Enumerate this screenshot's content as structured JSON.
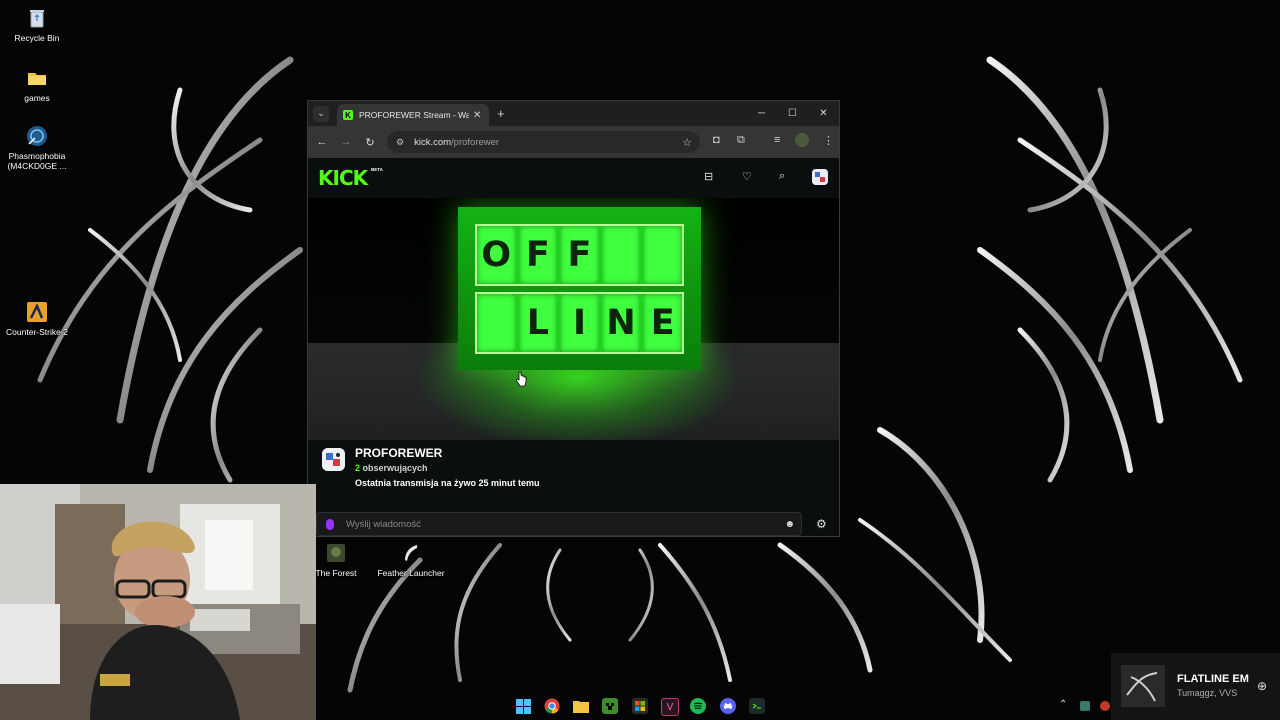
{
  "desktop": {
    "icons": [
      {
        "label": "Recycle Bin"
      },
      {
        "label": "games"
      },
      {
        "label": "Phasmophobia (M4CKD0GE ..."
      },
      {
        "label": "Counter-Strike 2"
      },
      {
        "label": "The Forest"
      },
      {
        "label": "Feather Launcher"
      }
    ]
  },
  "browser": {
    "tab_title": "PROFOREWER Stream - Watch Live",
    "url_domain": "kick.com",
    "url_path": "/proforewer"
  },
  "site": {
    "logo": "KICK",
    "logo_badge": "BETA"
  },
  "player": {
    "offline_row1": [
      "O",
      "F",
      "F",
      "",
      ""
    ],
    "offline_row2": [
      "",
      "L",
      "I",
      "N",
      "E"
    ]
  },
  "channel": {
    "name": "PROFOREWER",
    "followers_count": "2",
    "followers_label": "obserwujących",
    "last_stream": "Ostatnia transmisja na żywo 25 minut temu"
  },
  "chat": {
    "placeholder": "Wyślij wiadomość"
  },
  "media": {
    "title": "FLATLINE EM",
    "artist": "Tumaggz, VVS"
  },
  "colors": {
    "kick_green": "#53fc18",
    "mic_purple": "#9b30ff"
  }
}
